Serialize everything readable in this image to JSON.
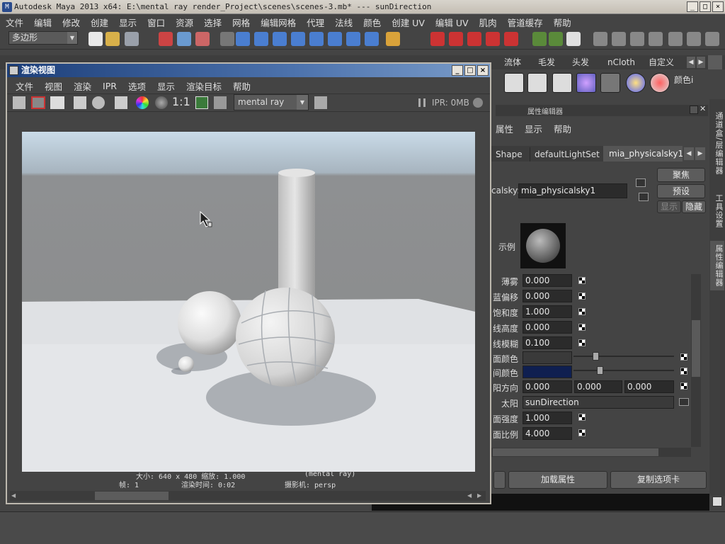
{
  "main_window": {
    "title": "Autodesk Maya 2013 x64: E:\\mental ray render_Project\\scenes\\scenes-3.mb*   ---   sunDirection",
    "controls": [
      "_",
      "□",
      "×"
    ]
  },
  "menubar": [
    "文件",
    "编辑",
    "修改",
    "创建",
    "显示",
    "窗口",
    "资源",
    "选择",
    "网格",
    "编辑网格",
    "代理",
    "法线",
    "颜色",
    "创建 UV",
    "编辑 UV",
    "肌肉",
    "管道缓存",
    "帮助"
  ],
  "mode_selector": "多边形",
  "shelf_tabs": [
    "流体",
    "毛发",
    "头发",
    "nCloth",
    "自定义"
  ],
  "render_view": {
    "title": "渲染视图",
    "controls": [
      "_",
      "□",
      "×"
    ],
    "menu": [
      "文件",
      "视图",
      "渲染",
      "IPR",
      "选项",
      "显示",
      "渲染目标",
      "帮助"
    ],
    "ratio_label": "1:1",
    "renderer": "mental ray",
    "ipr_status": "IPR: 0MB",
    "info_line1_size": "大小: 640 x 480 缩放: 1.000",
    "info_line1_renderer": "(mental ray)",
    "info_line2_frame": "帧: 1",
    "info_line2_time": "渲染时间: 0:02",
    "info_line2_camera": "摄影机: persp"
  },
  "attribute_editor": {
    "header": "属性编辑器",
    "menu": [
      "属性",
      "显示",
      "帮助"
    ],
    "tabs": [
      "Shape",
      "defaultLightSet",
      "mia_physicalsky1"
    ],
    "node_label": "calsky:",
    "node_value": "mia_physicalsky1",
    "buttons": {
      "focus": "聚焦",
      "presets": "预设",
      "show": "显示",
      "hide": "隐藏",
      "load_attrs": "加载属性",
      "copy_tab": "复制选项卡"
    },
    "sample_label": "示例",
    "attrs": [
      {
        "label": "薄雾",
        "values": [
          "0.000"
        ]
      },
      {
        "label": "蓝偏移",
        "values": [
          "0.000"
        ]
      },
      {
        "label": "饱和度",
        "values": [
          "1.000"
        ]
      },
      {
        "label": "线高度",
        "values": [
          "0.000"
        ]
      },
      {
        "label": "线模糊",
        "values": [
          "0.100"
        ]
      },
      {
        "label": "面颜色",
        "values": []
      },
      {
        "label": "间颜色",
        "values": []
      },
      {
        "label": "阳方向",
        "values": [
          "0.000",
          "0.000",
          "0.000"
        ]
      },
      {
        "label": "太阳",
        "values": [
          "sunDirection"
        ]
      },
      {
        "label": "面强度",
        "values": [
          "1.000"
        ]
      },
      {
        "label": "面比例",
        "values": [
          "4.000"
        ]
      }
    ],
    "side_tabs": [
      "通道盒/层编辑器",
      "工具设置",
      "属性编辑器"
    ],
    "shelf_color_label": "颜色i"
  },
  "colors": {
    "accent_blue": "#1d3f7a",
    "night_color": "#0f1f50",
    "panel_bg": "#444444"
  }
}
